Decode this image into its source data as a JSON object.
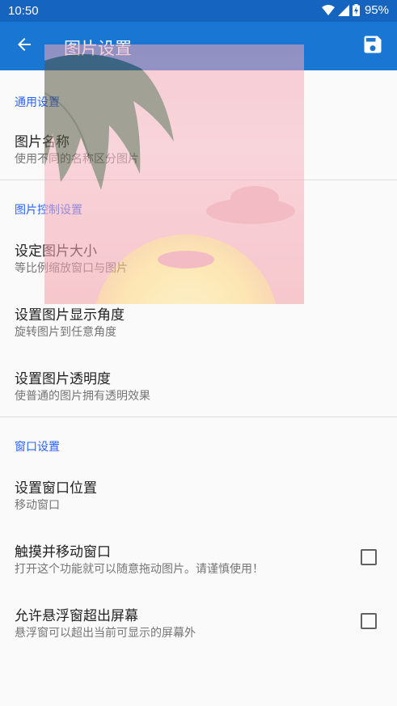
{
  "status_bar": {
    "time": "10:50",
    "battery": "95%",
    "icons": [
      "wifi-icon",
      "signal-icon",
      "battery-charging-icon"
    ]
  },
  "app_bar": {
    "title": "图片设置",
    "back_icon": "arrow-back-icon",
    "save_icon": "save-icon"
  },
  "colors": {
    "status_bar": "#1565c0",
    "app_bar": "#1976d2",
    "section_header": "#2962ff",
    "background": "#fafafa"
  },
  "sections": [
    {
      "header": "通用设置",
      "items": [
        {
          "title": "图片名称",
          "summary": "使用不同的名称区分图片"
        }
      ]
    },
    {
      "header": "图片控制设置",
      "items": [
        {
          "title": "设定图片大小",
          "summary": "等比例缩放窗口与图片"
        },
        {
          "title": "设置图片显示角度",
          "summary": "旋转图片到任意角度"
        },
        {
          "title": "设置图片透明度",
          "summary": "使普通的图片拥有透明效果"
        }
      ]
    },
    {
      "header": "窗口设置",
      "items": [
        {
          "title": "设置窗口位置",
          "summary": "移动窗口"
        },
        {
          "title": "触摸并移动窗口",
          "summary": "打开这个功能就可以随意拖动图片。请谨慎使用！",
          "checked": false
        },
        {
          "title": "允许悬浮窗超出屏幕",
          "summary": "悬浮窗可以超出当前可显示的屏幕外",
          "checked": false
        }
      ]
    }
  ]
}
